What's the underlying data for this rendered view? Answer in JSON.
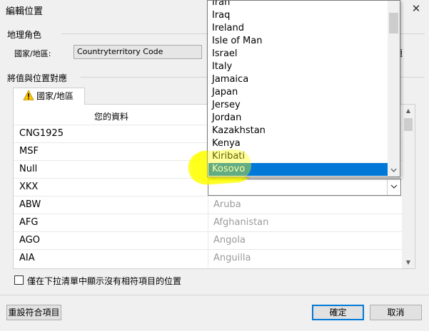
{
  "window": {
    "title": "編輯位置",
    "close_glyph": "✕"
  },
  "geo_section": {
    "label": "地理角色",
    "field_label": "國家/地區:",
    "field_value": "Countryterritory Code",
    "right_label": "題"
  },
  "mapping_section": {
    "label": "將值與位置對應",
    "tab_label": "國家/地區",
    "warning_icon": "warning-triangle-icon",
    "column_header": "您的資料",
    "rows": [
      {
        "value": "CNG1925",
        "location": ""
      },
      {
        "value": "MSF",
        "location": ""
      },
      {
        "value": "Null",
        "location": ""
      },
      {
        "value": "XKX",
        "location": "",
        "editing": true
      },
      {
        "value": "ABW",
        "location": "Aruba"
      },
      {
        "value": "AFG",
        "location": "Afghanistan"
      },
      {
        "value": "AGO",
        "location": "Angola"
      },
      {
        "value": "AIA",
        "location": "Anguilla"
      }
    ]
  },
  "dropdown": {
    "items": [
      "Iran",
      "Iraq",
      "Ireland",
      "Isle of Man",
      "Israel",
      "Italy",
      "Jamaica",
      "Japan",
      "Jersey",
      "Jordan",
      "Kazakhstan",
      "Kenya",
      "Kiribati",
      "Kosovo"
    ],
    "selected": "Kosovo",
    "selection_color": "#0078d7",
    "highlight_color": "#ffff00"
  },
  "checkbox": {
    "label": "僅在下拉清單中顯示沒有相符項目的位置",
    "checked": false
  },
  "buttons": {
    "reset": "重設符合項目",
    "ok": "確定",
    "cancel": "取消"
  }
}
